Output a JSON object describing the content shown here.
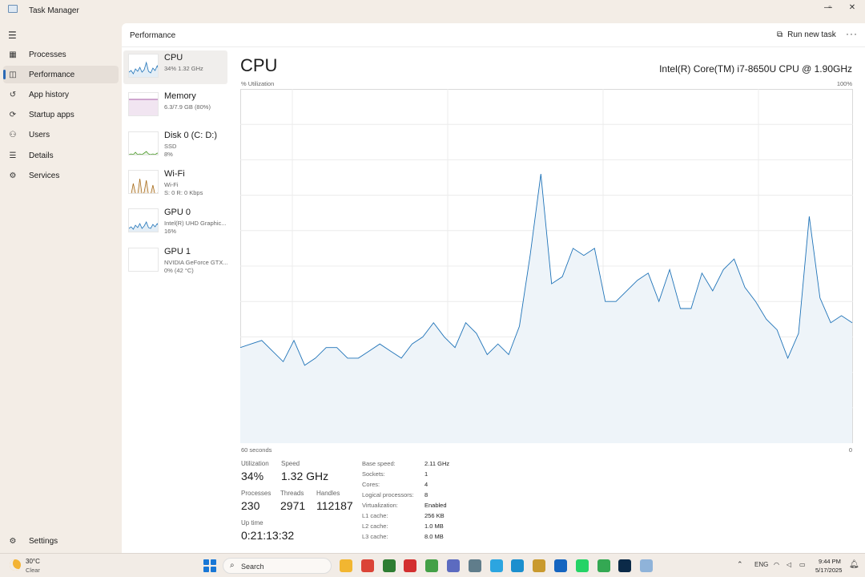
{
  "window": {
    "title": "Task Manager",
    "controls": {
      "minimize": "—",
      "restore": "▫",
      "close": "✕"
    }
  },
  "nav": {
    "items": [
      {
        "label": "Processes",
        "icon": "processes-icon",
        "glyph": "▦"
      },
      {
        "label": "Performance",
        "icon": "performance-icon",
        "glyph": "◫",
        "active": true
      },
      {
        "label": "App history",
        "icon": "app-history-icon",
        "glyph": "↺"
      },
      {
        "label": "Startup apps",
        "icon": "startup-apps-icon",
        "glyph": "⟳"
      },
      {
        "label": "Users",
        "icon": "users-icon",
        "glyph": "⚇"
      },
      {
        "label": "Details",
        "icon": "details-icon",
        "glyph": "☰"
      },
      {
        "label": "Services",
        "icon": "services-icon",
        "glyph": "⚙"
      }
    ],
    "settings": {
      "label": "Settings",
      "glyph": "⚙"
    }
  },
  "header": {
    "title": "Performance",
    "run_new_task": "Run new task",
    "more": "···"
  },
  "devices": [
    {
      "name": "CPU",
      "sub1": "34% 1.32 GHz",
      "sub2": "",
      "color": "#1f73b8",
      "active": true
    },
    {
      "name": "Memory",
      "sub1": "6.3/7.9 GB (80%)",
      "sub2": "",
      "color": "#8b2b8b"
    },
    {
      "name": "Disk 0 (C: D:)",
      "sub1": "SSD",
      "sub2": "8%",
      "color": "#4c9a2a"
    },
    {
      "name": "Wi-Fi",
      "sub1": "Wi-Fi",
      "sub2": "S: 0 R: 0 Kbps",
      "color": "#a76b19"
    },
    {
      "name": "GPU 0",
      "sub1": "Intel(R) UHD Graphic...",
      "sub2": "16%",
      "color": "#1f73b8"
    },
    {
      "name": "GPU 1",
      "sub1": "NVIDIA GeForce GTX...",
      "sub2": "0% (42 °C)",
      "color": "#1f73b8"
    }
  ],
  "cpu": {
    "title": "CPU",
    "model": "Intel(R) Core(TM) i7-8650U CPU @ 1.90GHz",
    "y_label": "% Utilization",
    "y_max_label": "100%",
    "x_left_label": "60 seconds",
    "x_right_label": "0",
    "accent": "#1f73b8",
    "fill": "#eef4f9"
  },
  "chart_data": {
    "type": "area",
    "ylabel": "% Utilization",
    "xlabel": "60 seconds",
    "ylim": [
      0,
      100
    ],
    "x": [
      60,
      59,
      58,
      57,
      56,
      55,
      54,
      53,
      52,
      51,
      50,
      49,
      48,
      47,
      46,
      45,
      44,
      43,
      42,
      41,
      40,
      39,
      38,
      37,
      36,
      35,
      34,
      33,
      32,
      31,
      30,
      29,
      28,
      27,
      26,
      25,
      24,
      23,
      22,
      21,
      20,
      19,
      18,
      17,
      16,
      15,
      14,
      13,
      12,
      11,
      10,
      9,
      8,
      7,
      6,
      5,
      4,
      3,
      2,
      1,
      0
    ],
    "series": [
      {
        "values": [
          27,
          28,
          29,
          26,
          23,
          29,
          22,
          24,
          27,
          27,
          24,
          24,
          26,
          28,
          26,
          24,
          28,
          30,
          34,
          30,
          27,
          34,
          31,
          25,
          28,
          25,
          33,
          53,
          76,
          45,
          47,
          55,
          53,
          55,
          40,
          40,
          43,
          46,
          48,
          40,
          49,
          38,
          38,
          48,
          43,
          49,
          52,
          44,
          40,
          35,
          32,
          24,
          31,
          64,
          41,
          34,
          36,
          34
        ]
      }
    ]
  },
  "stats": {
    "utilization": {
      "label": "Utilization",
      "value": "34%"
    },
    "speed": {
      "label": "Speed",
      "value": "1.32 GHz"
    },
    "processes": {
      "label": "Processes",
      "value": "230"
    },
    "threads": {
      "label": "Threads",
      "value": "2971"
    },
    "handles": {
      "label": "Handles",
      "value": "112187"
    },
    "uptime": {
      "label": "Up time",
      "value": "0:21:13:32"
    }
  },
  "specs": [
    {
      "k": "Base speed:",
      "v": "2.11 GHz"
    },
    {
      "k": "Sockets:",
      "v": "1"
    },
    {
      "k": "Cores:",
      "v": "4"
    },
    {
      "k": "Logical processors:",
      "v": "8"
    },
    {
      "k": "Virtualization:",
      "v": "Enabled"
    },
    {
      "k": "L1 cache:",
      "v": "256 KB"
    },
    {
      "k": "L2 cache:",
      "v": "1.0 MB"
    },
    {
      "k": "L3 cache:",
      "v": "8.0 MB"
    }
  ],
  "taskbar": {
    "weather_temp": "30°C",
    "weather_cond": "Clear",
    "search": "Search",
    "apps": [
      {
        "name": "file-explorer-icon",
        "color": "#f2b631"
      },
      {
        "name": "chrome-icon",
        "color": "#db4437"
      },
      {
        "name": "ninja-app-icon",
        "color": "#2e7d32"
      },
      {
        "name": "acrobat-icon",
        "color": "#d32f2f"
      },
      {
        "name": "green-app-icon",
        "color": "#43a047"
      },
      {
        "name": "tools-app-icon",
        "color": "#5c6bc0"
      },
      {
        "name": "calculator-icon",
        "color": "#607d8b"
      },
      {
        "name": "telegram-icon",
        "color": "#2ca5e0"
      },
      {
        "name": "edge-icon",
        "color": "#1b8fce"
      },
      {
        "name": "aljazeera-icon",
        "color": "#c99a2e"
      },
      {
        "name": "vpn-icon",
        "color": "#1565c0"
      },
      {
        "name": "whatsapp-icon",
        "color": "#25d366"
      },
      {
        "name": "drive-icon",
        "color": "#34a853"
      },
      {
        "name": "photoshop-icon",
        "color": "#0b2a48"
      },
      {
        "name": "task-manager-icon",
        "color": "#8fb3d9"
      }
    ],
    "lang": "ENG",
    "time": "9:44 PM",
    "date": "5/17/2025"
  }
}
